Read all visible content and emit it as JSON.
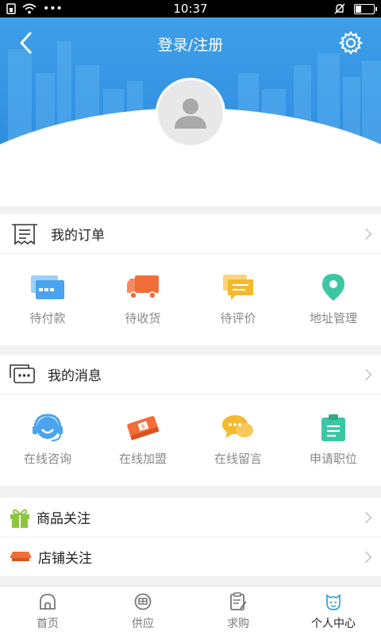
{
  "status_bar": {
    "time": "10:37",
    "dots": "•••",
    "battery_level": 0.35
  },
  "header": {
    "title": "登录/注册"
  },
  "orders": {
    "title": "我的订单",
    "items": [
      {
        "label": "待付款",
        "icon": "card-icon",
        "color": "#4aa3ee"
      },
      {
        "label": "待收货",
        "icon": "truck-icon",
        "color": "#f26d3a"
      },
      {
        "label": "待评价",
        "icon": "comment-icon",
        "color": "#f5b92e"
      },
      {
        "label": "地址管理",
        "icon": "location-pin-icon",
        "color": "#3cc7a4"
      }
    ]
  },
  "messages": {
    "title": "我的消息",
    "items": [
      {
        "label": "在线咨询",
        "icon": "headset-icon",
        "color": "#4aa3ee"
      },
      {
        "label": "在线加盟",
        "icon": "money-icon",
        "color": "#f26d3a"
      },
      {
        "label": "在线留言",
        "icon": "chat-bubbles-icon",
        "color": "#f5b92e"
      },
      {
        "label": "申请职位",
        "icon": "clipboard-icon",
        "color": "#3cc7a4"
      }
    ]
  },
  "follows": [
    {
      "label": "商品关注",
      "icon": "gift-icon"
    },
    {
      "label": "店铺关注",
      "icon": "shop-icon"
    }
  ],
  "tabs": [
    {
      "label": "首页",
      "icon": "home-icon",
      "active": false
    },
    {
      "label": "供应",
      "icon": "supply-icon",
      "active": false
    },
    {
      "label": "求购",
      "icon": "purchase-icon",
      "active": false
    },
    {
      "label": "个人中心",
      "icon": "profile-icon",
      "active": true
    }
  ],
  "colors": {
    "header_blue": "#3f9ee8",
    "active_tab": "#3aa3e3"
  }
}
